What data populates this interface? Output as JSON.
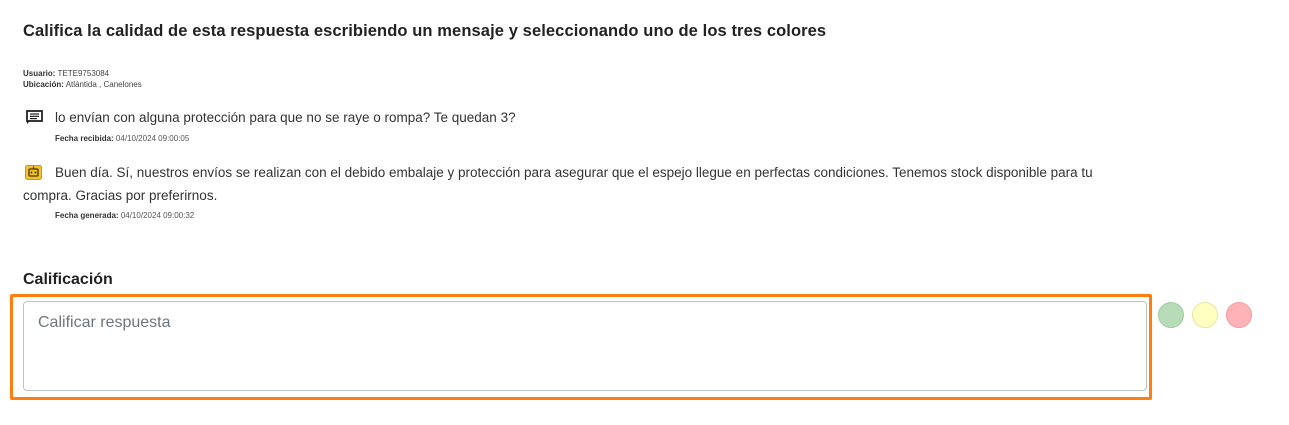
{
  "header": {
    "title": "Califica la calidad de esta respuesta escribiendo un mensaje y seleccionando uno de los tres colores"
  },
  "user_info": {
    "user_label": "Usuario:",
    "user_value": "TETE9753084",
    "location_label": "Ubicación:",
    "location_value": "Atlántida , Canelones"
  },
  "question": {
    "icon": "chat-message-icon",
    "text": "lo envían con alguna protección para que no se raye o rompa? Te quedan 3?",
    "date_label": "Fecha recibida:",
    "date_value": "04/10/2024 09:00:05"
  },
  "answer": {
    "icon": "bot-reply-icon",
    "text": "Buen día. Sí, nuestros envíos se realizan con el debido embalaje y protección para asegurar que el espejo llegue en perfectas condiciones. Tenemos stock disponible para tu compra. Gracias por preferirnos.",
    "date_label": "Fecha generada:",
    "date_value": "04/10/2024 09:00:32"
  },
  "rating": {
    "section_label": "Calificación",
    "input_placeholder": "Calificar respuesta",
    "input_value": "",
    "highlight_color": "#ff7f0e",
    "colors": [
      {
        "name": "green",
        "hex": "#b7dcb7"
      },
      {
        "name": "yellow",
        "hex": "#ffffc2"
      },
      {
        "name": "red",
        "hex": "#ffb3b6"
      }
    ]
  }
}
